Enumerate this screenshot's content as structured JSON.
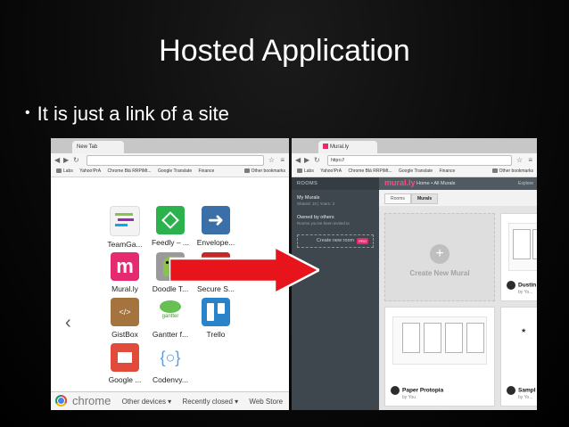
{
  "slide": {
    "title": "Hosted Application",
    "bullet": "It is just a link of a site"
  },
  "left_browser": {
    "tab_title": "New Tab",
    "url": "",
    "bookmarks": [
      "Labs",
      "Yahoo!PrA",
      "Chrome Blá RRPiMt...",
      "Google Translate",
      "Finance"
    ],
    "other_bookmarks": "Other bookmarks",
    "apps": [
      {
        "label": "TeamGa...",
        "icon": "teamgantt-icon",
        "color": "#f3f3f3"
      },
      {
        "label": "Feedly – ...",
        "icon": "feedly-icon",
        "color": "#2bb24c"
      },
      {
        "label": "Envelope...",
        "icon": "envelope-icon",
        "color": "#3b6fa8"
      },
      {
        "label": "Mural.ly",
        "icon": "muralty-icon",
        "color": "#e52a6f"
      },
      {
        "label": "Doodle T...",
        "icon": "doodle-icon",
        "color": "#b7b7b7"
      },
      {
        "label": "Secure S...",
        "icon": "secure-shell-icon",
        "color": "#2a2a2a"
      },
      {
        "label": "GistBox",
        "icon": "gistbox-icon",
        "color": "#a5733e"
      },
      {
        "label": "Gantter f...",
        "icon": "gantter-icon",
        "color": "#66c054"
      },
      {
        "label": "Trello",
        "icon": "trello-icon",
        "color": "#2a82c9"
      },
      {
        "label": "Google ...",
        "icon": "google-slides-icon",
        "color": "#e04b3b"
      },
      {
        "label": "Codenvy...",
        "icon": "codenvy-icon",
        "color": "#5b9bd5"
      }
    ],
    "footer": {
      "chrome": "chrome",
      "other_devices": "Other devices",
      "recently_closed": "Recently closed",
      "web_store": "Web Store"
    }
  },
  "right_browser": {
    "tab_title": "Mural.ly",
    "url": "https://",
    "bookmarks": [
      "Labs",
      "Yahoo!PrA",
      "Chrome Blá RRPiMt...",
      "Google Translate",
      "Finance"
    ],
    "other_bookmarks": "Other bookmarks",
    "rail": {
      "header": "ROOMS",
      "my_murals": "My Murals",
      "my_murals_sub": "Shared: 10 | Yours: 3",
      "owned_by_others": "Owned by others",
      "owned_sub": "Rooms you've been invited to",
      "create_room": "Create new room",
      "pro_badge": "PRO"
    },
    "topnav": {
      "logo": "mural.ly",
      "breadcrumb": "Home  •  All Murals",
      "right": "Explore"
    },
    "tabs": [
      "Rooms",
      "Murals"
    ],
    "cards": [
      {
        "type": "new",
        "label": "Create New Mural"
      },
      {
        "type": "mural",
        "title": "Dustin",
        "by": "by Yo..."
      },
      {
        "type": "mural",
        "title": "Paper Protopia",
        "by": "by You"
      },
      {
        "type": "mural",
        "title": "Sampl",
        "by": "by Yo..."
      }
    ],
    "colors": {
      "brand": "#e52a6f",
      "rail": "#3e474e"
    }
  },
  "arrow": {
    "color": "#e8141b"
  }
}
